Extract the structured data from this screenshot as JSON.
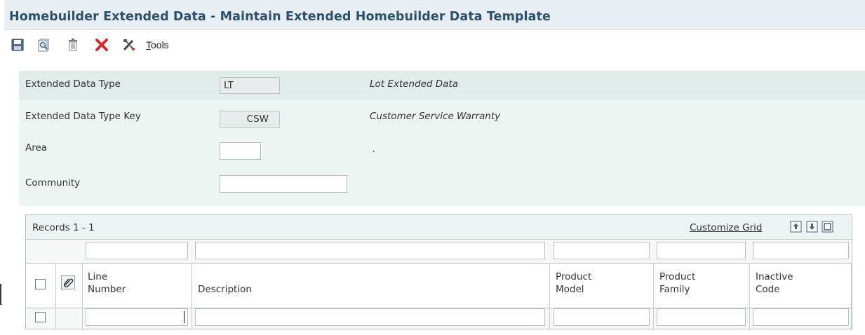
{
  "window": {
    "title": "Homebuilder Extended Data - Maintain Extended Homebuilder Data Template"
  },
  "toolbar": {
    "tools_prefix": "T",
    "tools_rest": "ools",
    "icons": [
      "save-icon",
      "find-icon",
      "delete-icon",
      "close-icon",
      "tools-icon"
    ]
  },
  "form": {
    "ext_type_label": "Extended Data Type",
    "ext_type_value": "LT",
    "ext_type_desc": "Lot Extended Data",
    "ext_key_label": "Extended Data Type Key",
    "ext_key_value": "CSW",
    "ext_key_desc": "Customer Service Warranty",
    "area_label": "Area",
    "area_value": "",
    "area_desc": ".",
    "community_label": "Community",
    "community_value": ""
  },
  "grid": {
    "records_label": "Records 1 - 1",
    "customize_label": "Customize Grid",
    "columns": {
      "line_number": [
        "Line",
        "Number"
      ],
      "description": "Description",
      "product_model": [
        "Product",
        "Model"
      ],
      "product_family": [
        "Product",
        "Family"
      ],
      "inactive_code": [
        "Inactive",
        "Code"
      ]
    },
    "rows": [
      {
        "line_number": "",
        "description": "",
        "product_model": "",
        "product_family": "",
        "inactive_code": ""
      }
    ]
  },
  "colors": {
    "title": "#29506f",
    "form_bg": "#eef4f1",
    "header_band": "#e1ebea",
    "delete_red": "#d12a2a"
  }
}
